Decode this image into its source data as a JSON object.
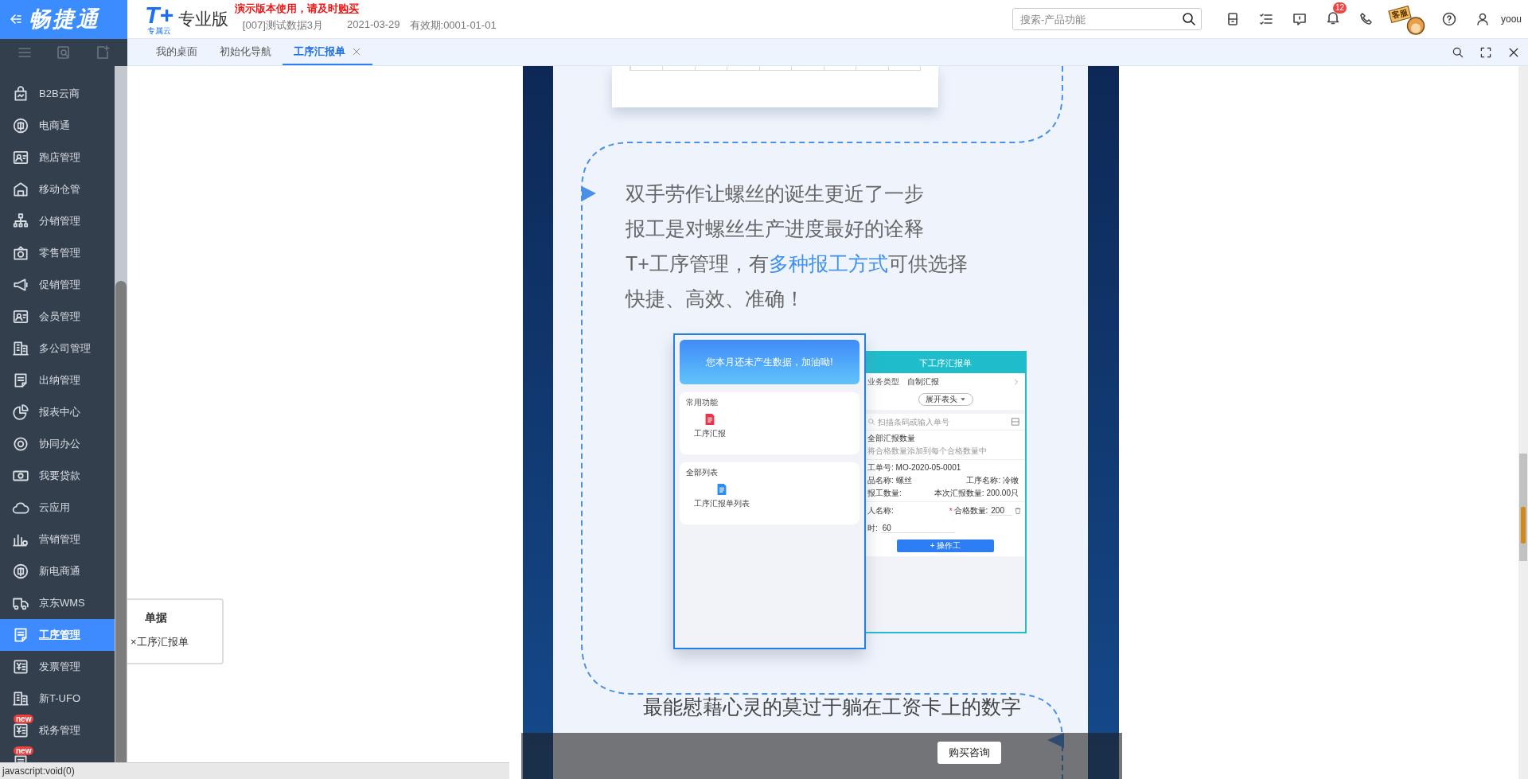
{
  "header": {
    "brand": "畅捷通",
    "product_logo": "T+",
    "product_sub": "专属云",
    "edition": "专业版",
    "notice": {
      "text": "演示版本使用，请及时",
      "link": "购买"
    },
    "account": "[007]测试数据3月",
    "date": "2021-03-29",
    "validity": "有效期:0001-01-01",
    "search": {
      "placeholder": "搜索-产品功能"
    },
    "notification_count": "12",
    "service_label": "客服",
    "user": "yoou"
  },
  "tabs": [
    {
      "label": "我的桌面",
      "selected": false,
      "closable": false
    },
    {
      "label": "初始化导航",
      "selected": false,
      "closable": false
    },
    {
      "label": "工序汇报单",
      "selected": true,
      "closable": true
    }
  ],
  "sidebar": {
    "items": [
      {
        "label": "B2B云商",
        "selected": false
      },
      {
        "label": "电商通",
        "selected": false
      },
      {
        "label": "跑店管理",
        "selected": false
      },
      {
        "label": "移动仓管",
        "selected": false
      },
      {
        "label": "分销管理",
        "selected": false
      },
      {
        "label": "零售管理",
        "selected": false
      },
      {
        "label": "促销管理",
        "selected": false
      },
      {
        "label": "会员管理",
        "selected": false
      },
      {
        "label": "多公司管理",
        "selected": false
      },
      {
        "label": "出纳管理",
        "selected": false
      },
      {
        "label": "报表中心",
        "selected": false
      },
      {
        "label": "协同办公",
        "selected": false
      },
      {
        "label": "我要贷款",
        "selected": false
      },
      {
        "label": "云应用",
        "selected": false
      },
      {
        "label": "营销管理",
        "selected": false
      },
      {
        "label": "新电商通",
        "selected": false
      },
      {
        "label": "京东WMS",
        "selected": false
      },
      {
        "label": "工序管理",
        "selected": true
      },
      {
        "label": "发票管理",
        "selected": false
      },
      {
        "label": "新T-UFO",
        "selected": false
      },
      {
        "label": "税务管理",
        "selected": false,
        "badge": "new"
      },
      {
        "selected": false,
        "badge": "new"
      }
    ]
  },
  "flyout": {
    "title": "单据",
    "items": [
      "×工序汇报单"
    ]
  },
  "content": {
    "intro_lines": [
      {
        "text": "双手劳作让螺丝的诞生更近了一步"
      },
      {
        "text": "报工是对螺丝生产进度最好的诠释"
      },
      {
        "text": "T+工序管理，有",
        "emphasis": "多种报工方式",
        "tail": "可供选择"
      },
      {
        "text": "快捷、高效、准确！"
      }
    ],
    "home_phone": {
      "banner": "您本月还未产生数据，加油呦!",
      "sections": [
        {
          "title": "常用功能",
          "items": [
            {
              "label": "工序汇报",
              "kind": "report"
            }
          ]
        },
        {
          "title": "全部列表",
          "items": [
            {
              "label": "工序汇报单列表",
              "kind": "list"
            }
          ]
        }
      ]
    },
    "report_form": {
      "title": "下工序汇报单",
      "business_type": {
        "label": "业务类型",
        "value": "自制汇报"
      },
      "expand_button": "展开表头",
      "scan": {
        "placeholder": "扫描条码或输入单号"
      },
      "batch": {
        "label": "全部汇报数量",
        "hint": "将合格数量添加到每个合格数量中"
      },
      "order_no": "工单号: MO-2020-05-0001",
      "details": [
        [
          "品名称: 螺丝",
          "工序名称: 冷镦"
        ],
        [
          "报工数量:",
          "本次汇报数量: 200.00只"
        ]
      ],
      "worker": {
        "label": "人名称:"
      },
      "qualified": {
        "mark": "*",
        "label": "合格数量:",
        "value": "200"
      },
      "hours": {
        "label": "时:",
        "value": "60"
      },
      "add_button": "+ 操作工"
    },
    "closing_lines": [
      "最能慰藉心灵的莫过于躺在工资卡上的数字"
    ]
  },
  "purchase_button": "购买咨询",
  "status_bar": "javascript:void(0)"
}
